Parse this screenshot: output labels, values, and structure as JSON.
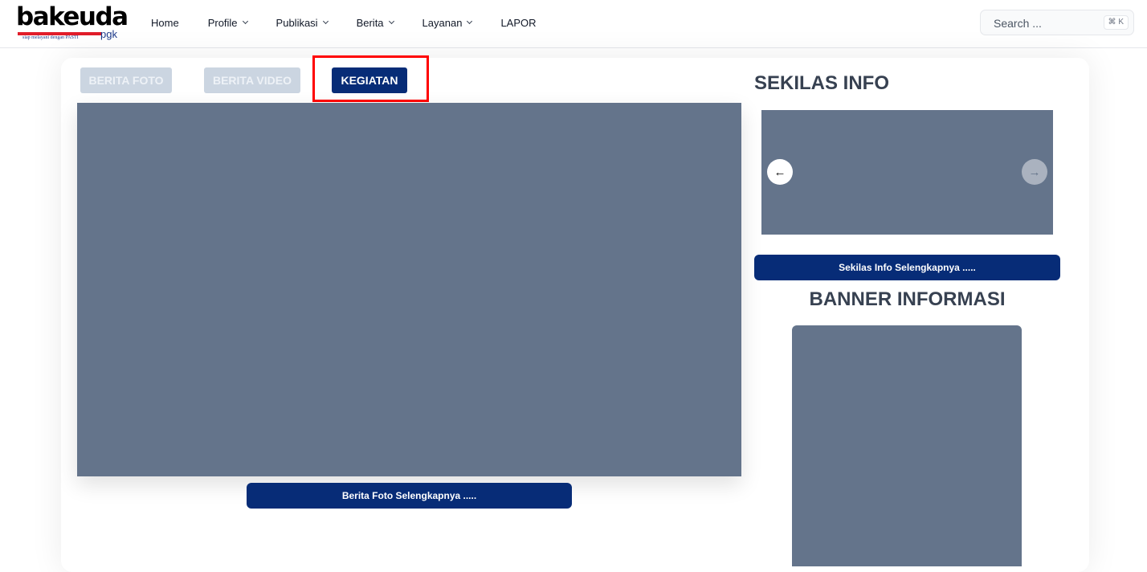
{
  "header": {
    "logo": {
      "brand": "bakeuda",
      "suffix": "pgk",
      "tagline": "siap melayani dengan PASTI"
    },
    "nav": [
      {
        "label": "Home",
        "has_dropdown": false
      },
      {
        "label": "Profile",
        "has_dropdown": true
      },
      {
        "label": "Publikasi",
        "has_dropdown": true
      },
      {
        "label": "Berita",
        "has_dropdown": true
      },
      {
        "label": "Layanan",
        "has_dropdown": true
      },
      {
        "label": "LAPOR",
        "has_dropdown": false
      }
    ],
    "search": {
      "placeholder": "Search ...",
      "shortcut": "⌘ K"
    }
  },
  "tabs": [
    {
      "label": "BERITA FOTO",
      "state": "inactive"
    },
    {
      "label": "BERITA VIDEO",
      "state": "inactive"
    },
    {
      "label": "KEGIATAN",
      "state": "active"
    }
  ],
  "main": {
    "more_label": "Berita Foto Selengkapnya ....."
  },
  "sidebar": {
    "sekilas_title": "SEKILAS INFO",
    "sekilas_more_label": "Sekilas Info Selengkapnya .....",
    "banner_title": "BANNER INFORMASI",
    "prev_icon": "←",
    "next_icon": "→"
  },
  "colors": {
    "brand_red": "#e11d2a",
    "primary_navy": "#072c77",
    "placeholder": "#64748b",
    "highlight": "#ff0000"
  }
}
